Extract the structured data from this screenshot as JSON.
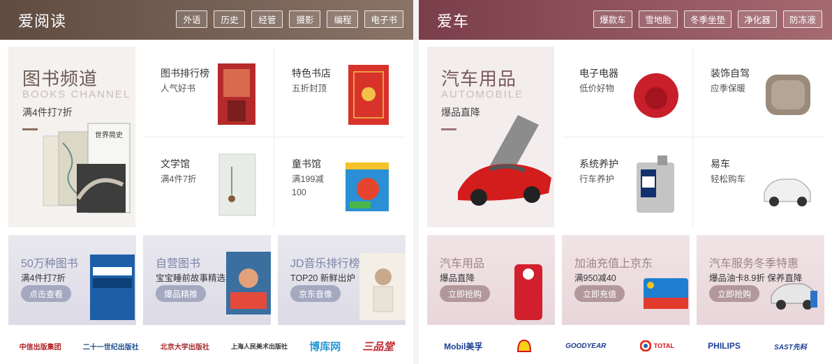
{
  "left": {
    "title": "爱阅读",
    "tags": [
      "外语",
      "历史",
      "经管",
      "摄影",
      "编程",
      "电子书"
    ],
    "feature": {
      "title": "图书频道",
      "en": "BOOKS CHANNEL",
      "sub": "满4件打7折"
    },
    "cells": [
      {
        "name": "图书排行榜",
        "desc": "人气好书"
      },
      {
        "name": "特色书店",
        "desc": "五折封顶"
      },
      {
        "name": "文学馆",
        "desc": "满4件7折"
      },
      {
        "name": "童书馆",
        "desc": "满199减100"
      }
    ],
    "promos": [
      {
        "title": "50万种图书",
        "desc": "满4件打7折",
        "btn": "点击查看"
      },
      {
        "title": "自营图书",
        "desc": "宝宝睡前故事精选",
        "btn": "爆品精推"
      },
      {
        "title": "JD音乐排行榜",
        "desc": "TOP20 新鲜出炉",
        "btn": "京东音像"
      }
    ],
    "logos": [
      "中信出版集团",
      "二十一世纪出版社",
      "北京大学出版社",
      "上海人民美术出版社",
      "博库网",
      "三品堂"
    ]
  },
  "right": {
    "title": "爱车",
    "tags": [
      "爆款车",
      "雪地胎",
      "冬季坐垫",
      "净化器",
      "防冻液"
    ],
    "feature": {
      "title": "汽车用品",
      "en": "AUTOMOBILE",
      "sub": "爆品直降"
    },
    "cells": [
      {
        "name": "电子电器",
        "desc": "低价好物"
      },
      {
        "name": "装饰自驾",
        "desc": "应季保暖"
      },
      {
        "name": "系统养护",
        "desc": "行车养护"
      },
      {
        "name": "易车",
        "desc": "轻松购车"
      }
    ],
    "promos": [
      {
        "title": "汽车用品",
        "desc": "爆品直降",
        "btn": "立即抢购"
      },
      {
        "title": "加油充值上京东",
        "desc": "满950减40",
        "btn": "立即充值"
      },
      {
        "title": "汽车服务冬季特惠",
        "desc": "爆品油卡8.9折 保养直降",
        "btn": "立即抢购"
      }
    ],
    "logos": [
      "Mobil美孚",
      "Shell",
      "GOODYEAR",
      "TOTAL",
      "PHILIPS",
      "SAST先科"
    ]
  }
}
